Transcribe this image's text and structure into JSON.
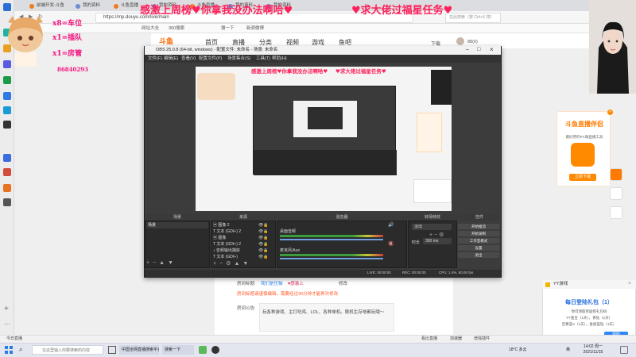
{
  "browser": {
    "tabs": [
      {
        "label": "前端开发-斗鱼"
      },
      {
        "label": "我的资料"
      },
      {
        "label": "斗鱼直播"
      },
      {
        "label": "我的资料"
      },
      {
        "label": "斗鱼直播"
      },
      {
        "label": "我的资料"
      },
      {
        "label": "我的资料"
      }
    ],
    "url": "https://mp.douyu.com/live/main",
    "search_placeholder": "在此搜索（按 Ctrl+K 搜）",
    "bookmarks": [
      "网址大全",
      "360搜索",
      "搜一下",
      "新浪微博"
    ],
    "status_left": "今日直播",
    "status_items": [
      "看比直播",
      "加速器",
      "增强插件"
    ]
  },
  "douyu": {
    "logo": "斗鱼",
    "nav": [
      "首页",
      "直播",
      "分类",
      "视频",
      "游戏",
      "鱼吧"
    ],
    "download": "下载",
    "avatar_name": "88(0)"
  },
  "danmu": {
    "line1": "感激上周榜♥你拿我没办法啊哈♥",
    "line2": "♥求大佬过福星任务♥"
  },
  "overlay": {
    "rows": [
      "x8=车位",
      "x1=插队",
      "x1=房管"
    ],
    "fan_id": "86840293"
  },
  "ad": {
    "title": "斗鱼直播伴侣",
    "sub": "最好用的PC端直播工具",
    "button": "立即下载"
  },
  "obs": {
    "title": "OBS 25.0.8 (64-bit, windows) - 配置文件: 未命名 - 场景: 未命名",
    "menu": [
      "文件(F)",
      "编辑(E)",
      "查看(V)",
      "配置文件(P)",
      "场景集合(S)",
      "工具(T)",
      "帮助(H)"
    ],
    "docks": {
      "scenes": "场景",
      "sources": "来源",
      "mixer": "混音器",
      "transitions": "转场特效",
      "controls": "控件"
    },
    "scene_item": "场景",
    "sources": [
      {
        "name": "图像 2"
      },
      {
        "name": "文本 (GDI+) 2"
      },
      {
        "name": "图像"
      },
      {
        "name": "文本 (GDI+) 2"
      },
      {
        "name": "音频输出捕获"
      },
      {
        "name": "文本 (GDI+)"
      }
    ],
    "mixer": [
      {
        "name": "桌面音频"
      },
      {
        "name": "麦克风/Aux"
      }
    ],
    "transition": "淡出",
    "duration_label": "时长",
    "duration_value": "300 ms",
    "controls": [
      "开始推流",
      "开始录制",
      "工作室模式",
      "设置",
      "退出"
    ],
    "status": {
      "live": "LIVE: 00:00:00",
      "rec": "REC: 00:00:00",
      "cpu": "CPU: 1.4%, 60.00 fps"
    }
  },
  "room": {
    "title_label": "房间标题:",
    "title_value": "我们是压轴",
    "title_suffix": "♥感激上",
    "edit": "修改",
    "warning": "房间标题请谨慎编辑，需要经过30分钟才能再次修改",
    "notice_label": "房间公告:",
    "notice_value": "玩各种游戏、主打吃鸡、LOL、各种单机。联机生存啥都玩哦～"
  },
  "yy": {
    "head": "YY游戏",
    "title": "每日登陆礼包（1）",
    "line1": "你可领取奖励到礼包码",
    "line2": "YY金豆（1天），青钻（1天）",
    "line3": "至尊蓝V（1天），金质蓝钻（1天）",
    "button": "领取"
  },
  "taskbar": {
    "search_placeholder": "在这里输入你要搜索的内容",
    "tasks": [
      "中国全网直播搜索平台",
      "搜索一下"
    ],
    "temp": "18°C 多云",
    "time": "14:02 周一",
    "date": "2021/11/15",
    "lang": "英"
  },
  "colors": {
    "danmu": "#ff1f5a",
    "fan": "#f4127e",
    "douyu_orange": "#ff6a00",
    "obs_dark": "#2b2b2b"
  }
}
